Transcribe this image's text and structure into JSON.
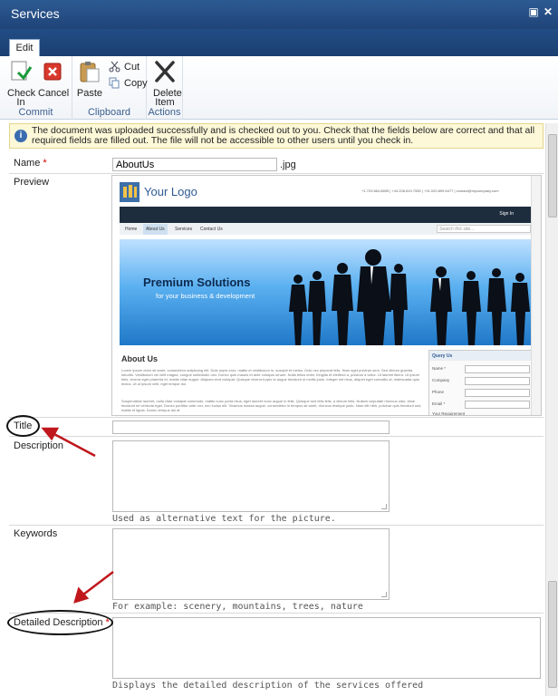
{
  "window": {
    "title": "Services"
  },
  "ribbon": {
    "tab": "Edit",
    "groups": {
      "commit": "Commit",
      "clipboard": "Clipboard",
      "actions": "Actions"
    },
    "buttons": {
      "check_in": "Check In",
      "cancel": "Cancel",
      "paste": "Paste",
      "cut": "Cut",
      "copy": "Copy",
      "delete_item": "Delete Item"
    }
  },
  "notice": "The document was uploaded successfully and is checked out to you. Check that the fields below are correct and that all required fields are filled out. The file will not be accessible to other users until you check in.",
  "form": {
    "name": {
      "label": "Name",
      "required": "*",
      "value": "AboutUs",
      "extension": ".jpg"
    },
    "preview": {
      "label": "Preview"
    },
    "title": {
      "label": "Title",
      "value": ""
    },
    "description": {
      "label": "Description",
      "hint": "Used as alternative text for the picture."
    },
    "keywords": {
      "label": "Keywords",
      "hint": "For example: scenery, mountains, trees, nature"
    },
    "detailed": {
      "label": "Detailed Description",
      "required": "*",
      "hint": "Displays the detailed description of the services offered"
    }
  },
  "preview_site": {
    "logo": "Your Logo",
    "contacts": "+1.703.664.8895 | +44.208.819.7550 | +31.020.899.6477 | contact@mycompany.com",
    "signin": "Sign In",
    "nav": [
      "Home",
      "About Us",
      "Services",
      "Contact Us"
    ],
    "search": "Search this site...",
    "hero_title": "Premium Solutions",
    "hero_sub": "for your business & development",
    "about_title": "About Us",
    "about_p1": "Lorem ipsum dolor sit amet, consectetur adipiscing elit. Duis turpis eros, mattis et vestibulum in, suscipit et metus. Duis nec placerat felis. Nam eget pulvinar sem. Sed dictum gravida lobortis. Vestibulum vel velit magna, congue sollicitudin orci. Donec quis mauris et ante volutpat ornare. Nulla tellus enim, fringilla et eleifend a, pulvinar a tortor. Ut laoreet libero. Ut ipsum felis, viverra eget pharetra et, mattis vitae augue. Aliquam erat volutpat. Quisque viverra turpis ut augue tincidunt ut mollis justo. Integer est risus, aliquet eget convallis at, malesuada quis lectus. Ut ut ipsum velit, eget tempor dui.",
    "about_p2": "Suspendisse laoreet, nulla vitae volutpat commodo, mattis nunc porta risus, eget laoreet nunc augue in felis. Quisque sed felis felis, a dictum felis. Nullam vulputate rhoncus odio, vitae tincidunt mi vehicula eget. Donec porttitor ante orci, nec luctus elit. Vivamus massa augue, consectetur in tempus sit amet, rhoncus tristique justo. Nam elit nibh, pulvinar quis tincidunt sed, mattis et ligula. Donec tempus dui at",
    "query": {
      "title": "Query Us",
      "fields": [
        "Name *",
        "Company",
        "Phone",
        "Email *"
      ],
      "req": "Your Requirement"
    }
  }
}
